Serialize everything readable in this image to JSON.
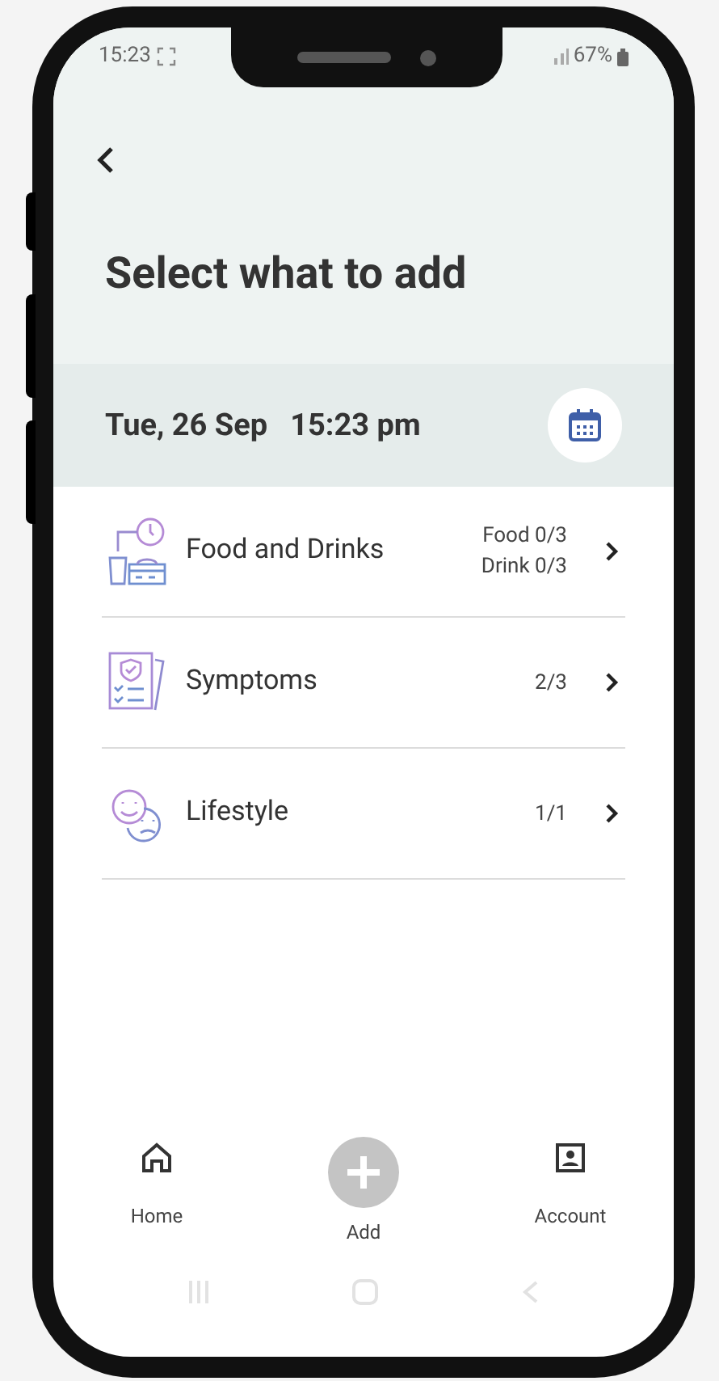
{
  "status_bar": {
    "time": "15:23",
    "battery": "67%"
  },
  "header": {
    "title": "Select what to add"
  },
  "date_bar": {
    "date": "Tue, 26 Sep",
    "time": "15:23 pm"
  },
  "categories": [
    {
      "kind": "food",
      "label": "Food and Drinks",
      "counts": [
        "Food 0/3",
        "Drink 0/3"
      ]
    },
    {
      "kind": "symptoms",
      "label": "Symptoms",
      "counts": [
        "2/3"
      ]
    },
    {
      "kind": "lifestyle",
      "label": "Lifestyle",
      "counts": [
        "1/1"
      ]
    }
  ],
  "bottom_nav": [
    {
      "kind": "home",
      "label": "Home"
    },
    {
      "kind": "add",
      "label": "Add"
    },
    {
      "kind": "account",
      "label": "Account"
    }
  ]
}
